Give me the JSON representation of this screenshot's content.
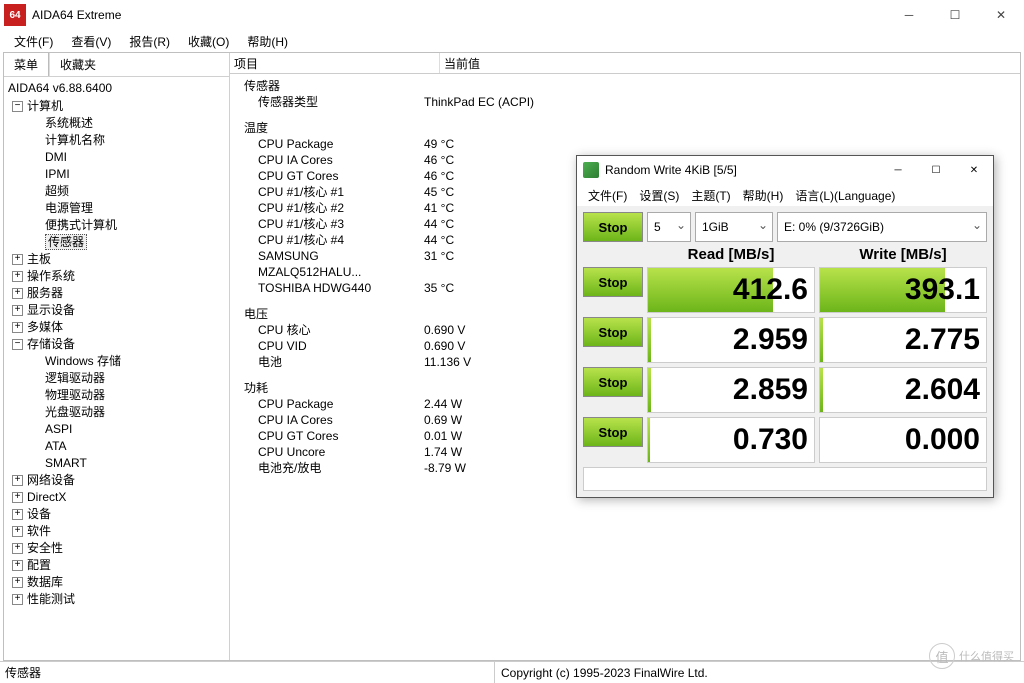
{
  "app": {
    "title": "AIDA64 Extreme",
    "logo": "64"
  },
  "menus": [
    "文件(F)",
    "查看(V)",
    "报告(R)",
    "收藏(O)",
    "帮助(H)"
  ],
  "sidebar": {
    "tabs": [
      "菜单",
      "收藏夹"
    ],
    "version": "AIDA64 v6.88.6400",
    "tree": [
      {
        "tw": "-",
        "label": "计算机",
        "lvl": 1
      },
      {
        "label": "系统概述",
        "lvl": 2
      },
      {
        "label": "计算机名称",
        "lvl": 2
      },
      {
        "label": "DMI",
        "lvl": 2
      },
      {
        "label": "IPMI",
        "lvl": 2
      },
      {
        "label": "超频",
        "lvl": 2
      },
      {
        "label": "电源管理",
        "lvl": 2
      },
      {
        "label": "便携式计算机",
        "lvl": 2
      },
      {
        "label": "传感器",
        "lvl": 2,
        "sel": true
      },
      {
        "tw": "+",
        "label": "主板",
        "lvl": 1
      },
      {
        "tw": "+",
        "label": "操作系统",
        "lvl": 1
      },
      {
        "tw": "+",
        "label": "服务器",
        "lvl": 1
      },
      {
        "tw": "+",
        "label": "显示设备",
        "lvl": 1
      },
      {
        "tw": "+",
        "label": "多媒体",
        "lvl": 1
      },
      {
        "tw": "-",
        "label": "存储设备",
        "lvl": 1
      },
      {
        "label": "Windows 存储",
        "lvl": 2
      },
      {
        "label": "逻辑驱动器",
        "lvl": 2
      },
      {
        "label": "物理驱动器",
        "lvl": 2
      },
      {
        "label": "光盘驱动器",
        "lvl": 2
      },
      {
        "label": "ASPI",
        "lvl": 2
      },
      {
        "label": "ATA",
        "lvl": 2
      },
      {
        "label": "SMART",
        "lvl": 2
      },
      {
        "tw": "+",
        "label": "网络设备",
        "lvl": 1
      },
      {
        "tw": "+",
        "label": "DirectX",
        "lvl": 1
      },
      {
        "tw": "+",
        "label": "设备",
        "lvl": 1
      },
      {
        "tw": "+",
        "label": "软件",
        "lvl": 1
      },
      {
        "tw": "+",
        "label": "安全性",
        "lvl": 1
      },
      {
        "tw": "+",
        "label": "配置",
        "lvl": 1
      },
      {
        "tw": "+",
        "label": "数据库",
        "lvl": 1
      },
      {
        "tw": "+",
        "label": "性能测试",
        "lvl": 1
      }
    ]
  },
  "content": {
    "headers": [
      "项目",
      "当前值"
    ],
    "sections": [
      {
        "title": "传感器",
        "rows": [
          {
            "l": "传感器类型",
            "v": "ThinkPad EC  (ACPI)"
          }
        ]
      },
      {
        "title": "温度",
        "rows": [
          {
            "l": "CPU Package",
            "v": "49 °C"
          },
          {
            "l": "CPU IA Cores",
            "v": "46 °C"
          },
          {
            "l": "CPU GT Cores",
            "v": "46 °C"
          },
          {
            "l": "CPU #1/核心 #1",
            "v": "45 °C"
          },
          {
            "l": "CPU #1/核心 #2",
            "v": "41 °C"
          },
          {
            "l": "CPU #1/核心 #3",
            "v": "44 °C"
          },
          {
            "l": "CPU #1/核心 #4",
            "v": "44 °C"
          },
          {
            "l": "SAMSUNG MZALQ512HALU...",
            "v": "31 °C"
          },
          {
            "l": "TOSHIBA HDWG440",
            "v": "35 °C"
          }
        ]
      },
      {
        "title": "电压",
        "rows": [
          {
            "l": "CPU 核心",
            "v": "0.690 V"
          },
          {
            "l": "CPU VID",
            "v": "0.690 V"
          },
          {
            "l": "电池",
            "v": "11.136 V"
          }
        ]
      },
      {
        "title": "功耗",
        "rows": [
          {
            "l": "CPU Package",
            "v": "2.44 W"
          },
          {
            "l": "CPU IA Cores",
            "v": "0.69 W"
          },
          {
            "l": "CPU GT Cores",
            "v": "0.01 W"
          },
          {
            "l": "CPU Uncore",
            "v": "1.74 W"
          },
          {
            "l": "电池充/放电",
            "v": "-8.79 W"
          }
        ]
      }
    ]
  },
  "status": {
    "left": "传感器",
    "right": "Copyright (c) 1995-2023 FinalWire Ltd."
  },
  "cdm": {
    "title": "Random Write 4KiB [5/5]",
    "menus": [
      "文件(F)",
      "设置(S)",
      "主题(T)",
      "帮助(H)",
      "语言(L)(Language)"
    ],
    "toprow": {
      "stop": "Stop",
      "count": "5",
      "size": "1GiB",
      "drive": "E: 0% (9/3726GiB)"
    },
    "headers": {
      "read": "Read [MB/s]",
      "write": "Write [MB/s]"
    },
    "rows": [
      {
        "stop": "Stop",
        "read": "412.6",
        "write": "393.1",
        "rclass": "running",
        "wclass": "running"
      },
      {
        "stop": "Stop",
        "read": "2.959",
        "write": "2.775",
        "rclass": "part",
        "wclass": "part"
      },
      {
        "stop": "Stop",
        "read": "2.859",
        "write": "2.604",
        "rclass": "part",
        "wclass": "part"
      },
      {
        "stop": "Stop",
        "read": "0.730",
        "write": "0.000",
        "rclass": "part2",
        "wclass": ""
      }
    ]
  },
  "watermark": "什么值得买"
}
